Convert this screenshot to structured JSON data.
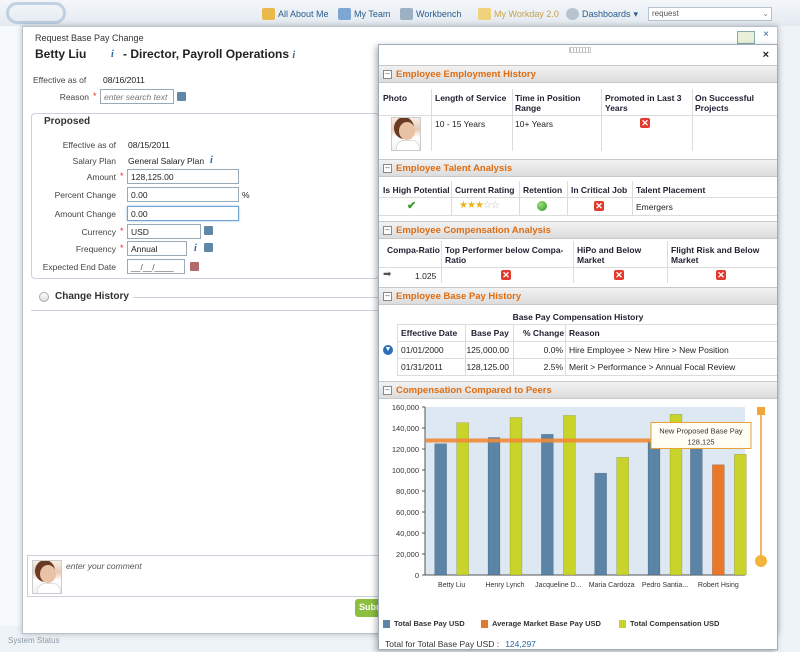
{
  "topnav": {
    "items": [
      "All About Me",
      "My Team",
      "Workbench",
      "My Workday 2.0",
      "Dashboards"
    ],
    "search_value": "request"
  },
  "system_status": "System Status",
  "dialog": {
    "title": "Request Base Pay Change",
    "employee_name": "Betty Liu",
    "separator": "-",
    "role": "Director, Payroll Operations",
    "effective_label": "Effective as of",
    "effective_value": "08/16/2011",
    "reason_label": "Reason",
    "reason_placeholder": "enter search text",
    "proposed": {
      "heading": "Proposed",
      "effective_label": "Effective as of",
      "effective_value": "08/15/2011",
      "salary_plan_label": "Salary Plan",
      "salary_plan_value": "General Salary Plan",
      "amount_label": "Amount",
      "amount_value": "128,125.00",
      "percent_label": "Percent Change",
      "percent_value": "0.00",
      "percent_unit": "%",
      "amount_change_label": "Amount Change",
      "amount_change_value": "0.00",
      "currency_label": "Currency",
      "currency_value": "USD",
      "frequency_label": "Frequency",
      "frequency_value": "Annual",
      "end_date_label": "Expected End Date",
      "end_date_value": "__/__/____"
    },
    "change_history_label": "Change History",
    "comment_placeholder": "enter your comment",
    "submit_label": "Submit"
  },
  "panel": {
    "employment": {
      "title": "Employee Employment History",
      "headers": [
        "Photo",
        "Length of Service",
        "Time in Position Range",
        "Promoted in Last 3 Years",
        "On Successful Projects"
      ],
      "length_of_service": "10 - 15 Years",
      "time_in_position": "10+ Years",
      "promoted": "no"
    },
    "talent": {
      "title": "Employee Talent Analysis",
      "headers": [
        "Is High Potential",
        "Current Rating",
        "Retention",
        "In Critical Job",
        "Talent Placement"
      ],
      "high_potential": "yes",
      "rating": 3,
      "rating_max": 5,
      "retention": "good",
      "critical_job": "no",
      "placement": "Emergers"
    },
    "compensation": {
      "title": "Employee Compensation Analysis",
      "headers": [
        "Compa-Ratio",
        "Top Performer below Compa-Ratio",
        "HiPo and Below Market",
        "Flight Risk and Below Market"
      ],
      "compa_ratio": "1.025"
    },
    "base_pay_history": {
      "title": "Employee Base Pay History",
      "table_title": "Base Pay Compensation History",
      "headers": [
        "Effective Date",
        "Base Pay",
        "% Change",
        "Reason"
      ],
      "rows": [
        {
          "date": "01/01/2000",
          "pay": "125,000.00",
          "change": "0.0%",
          "reason": "Hire Employee > New Hire > New Position"
        },
        {
          "date": "01/31/2011",
          "pay": "128,125.00",
          "change": "2.5%",
          "reason": "Merit > Performance > Annual Focal Review"
        }
      ]
    },
    "peers": {
      "title": "Compensation Compared to Peers",
      "total_label": "Total for Total Base Pay USD :",
      "total_value": "124,297",
      "tooltip_title": "New Proposed Base Pay",
      "tooltip_value": "128,125"
    }
  },
  "chart_data": {
    "type": "bar",
    "categories": [
      "Betty Liu",
      "Henry Lynch",
      "Jacqueline D...",
      "Maria Cardoza",
      "Pedro Santia...",
      "Robert Hsing"
    ],
    "series": [
      {
        "name": "Total Base Pay USD",
        "color": "#5b84a6",
        "values": [
          125000,
          131000,
          134000,
          97000,
          128000,
          124000
        ]
      },
      {
        "name": "Average Market Base Pay USD",
        "color": "#e8782a",
        "values": [
          null,
          null,
          null,
          null,
          null,
          105000
        ]
      },
      {
        "name": "Total Compensation USD",
        "color": "#c9d42a",
        "values": [
          145000,
          150000,
          152000,
          112000,
          153000,
          115000
        ]
      }
    ],
    "reference_line": {
      "value": 128125,
      "color": "#f28a36"
    },
    "ylim": [
      0,
      160000
    ],
    "yticks": [
      "0",
      "20,000",
      "40,000",
      "60,000",
      "80,000",
      "100,000",
      "120,000",
      "140,000",
      "160,000"
    ],
    "legend_position": "bottom",
    "grid": false
  }
}
